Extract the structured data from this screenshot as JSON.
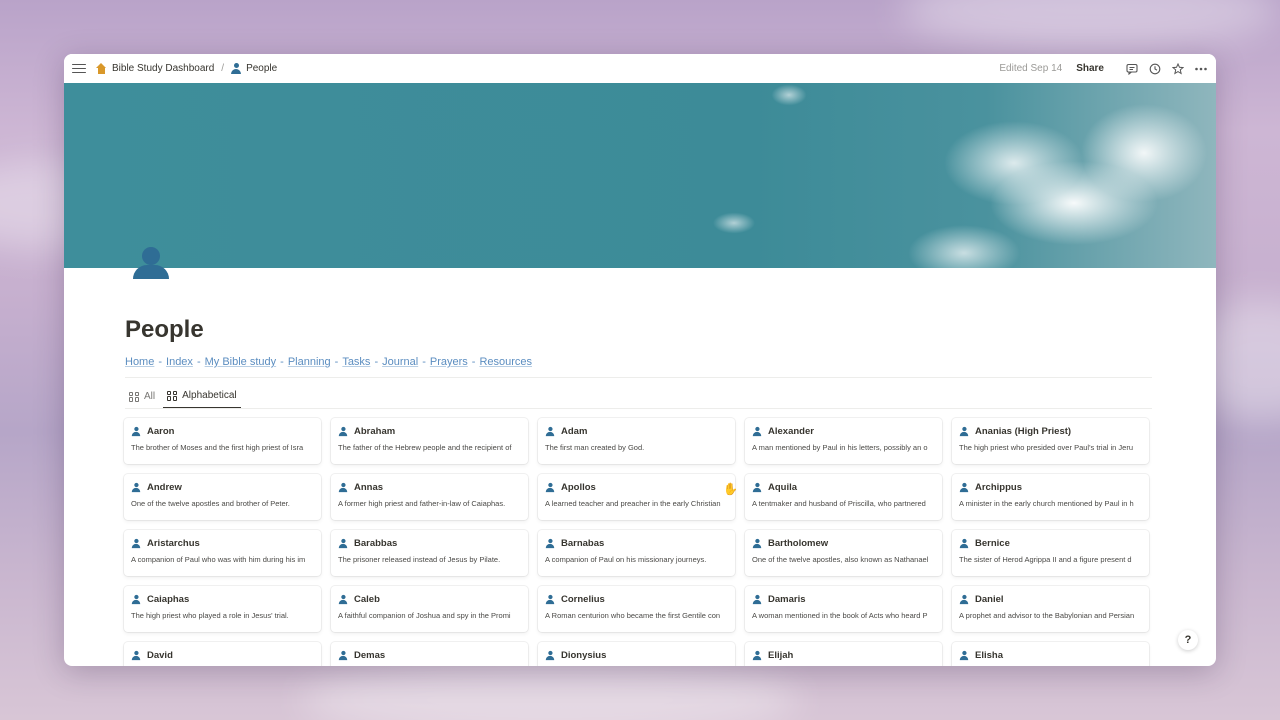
{
  "breadcrumb": {
    "parent": "Bible Study Dashboard",
    "separator": "/",
    "current": "People"
  },
  "topbar": {
    "edited": "Edited Sep 14",
    "share": "Share"
  },
  "page": {
    "title": "People",
    "links": [
      "Home",
      "Index",
      "My Bible study",
      "Planning",
      "Tasks",
      "Journal",
      "Prayers",
      "Resources"
    ],
    "link_separator": "-"
  },
  "views": [
    {
      "label": "All",
      "active": false
    },
    {
      "label": "Alphabetical",
      "active": true
    }
  ],
  "cards": [
    {
      "name": "Aaron",
      "desc": "The brother of Moses and the first high priest of Isra"
    },
    {
      "name": "Abraham",
      "desc": "The father of the Hebrew people and the recipient of"
    },
    {
      "name": "Adam",
      "desc": "The first man created by God."
    },
    {
      "name": "Alexander",
      "desc": "A man mentioned by Paul in his letters, possibly an o"
    },
    {
      "name": "Ananias (High Priest)",
      "desc": "The high priest who presided over Paul's trial in Jeru"
    },
    {
      "name": "Andrew",
      "desc": "One of the twelve apostles and brother of Peter."
    },
    {
      "name": "Annas",
      "desc": "A former high priest and father-in-law of Caiaphas."
    },
    {
      "name": "Apollos",
      "desc": "A learned teacher and preacher in the early Christian"
    },
    {
      "name": "Aquila",
      "desc": "A tentmaker and husband of Priscilla, who partnered"
    },
    {
      "name": "Archippus",
      "desc": "A minister in the early church mentioned by Paul in h"
    },
    {
      "name": "Aristarchus",
      "desc": "A companion of Paul who was with him during his im"
    },
    {
      "name": "Barabbas",
      "desc": "The prisoner released instead of Jesus by Pilate."
    },
    {
      "name": "Barnabas",
      "desc": "A companion of Paul on his missionary journeys."
    },
    {
      "name": "Bartholomew",
      "desc": "One of the twelve apostles, also known as Nathanael"
    },
    {
      "name": "Bernice",
      "desc": "The sister of Herod Agrippa II and a figure present d"
    },
    {
      "name": "Caiaphas",
      "desc": "The high priest who played a role in Jesus' trial."
    },
    {
      "name": "Caleb",
      "desc": "A faithful companion of Joshua and spy in the Promi"
    },
    {
      "name": "Cornelius",
      "desc": "A Roman centurion who became the first Gentile con"
    },
    {
      "name": "Damaris",
      "desc": "A woman mentioned in the book of Acts who heard P"
    },
    {
      "name": "Daniel",
      "desc": "A prophet and advisor to the Babylonian and Persian"
    },
    {
      "name": "David",
      "desc": ""
    },
    {
      "name": "Demas",
      "desc": ""
    },
    {
      "name": "Dionysius",
      "desc": ""
    },
    {
      "name": "Elijah",
      "desc": ""
    },
    {
      "name": "Elisha",
      "desc": ""
    }
  ],
  "help": "?",
  "icons": {
    "menu": "menu-icon",
    "home": "house-icon",
    "page": "person-icon",
    "comments": "comment-icon",
    "updates": "clock-icon",
    "favorite": "star-icon",
    "more": "more-icon"
  }
}
